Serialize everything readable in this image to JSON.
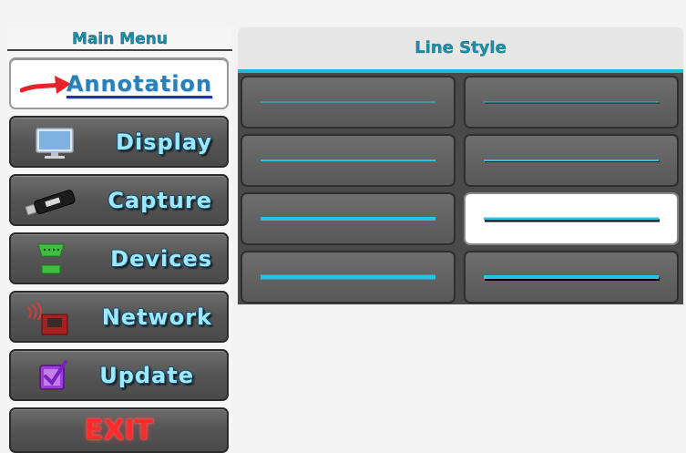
{
  "sidebar": {
    "title": "Main Menu",
    "items": [
      {
        "label": "Annotation",
        "icon": "red-arrow-icon",
        "active": true
      },
      {
        "label": "Display",
        "icon": "monitor-icon"
      },
      {
        "label": "Capture",
        "icon": "usb-stick-icon"
      },
      {
        "label": "Devices",
        "icon": "serial-port-icon"
      },
      {
        "label": "Network",
        "icon": "network-port-icon"
      },
      {
        "label": "Update",
        "icon": "checkbox-icon"
      },
      {
        "label": "EXIT",
        "icon": "exit-sign-icon"
      }
    ]
  },
  "panel": {
    "title": "Line Style",
    "accent_color": "#29c3e8",
    "line_options": [
      {
        "style": "thin-1",
        "shadow": false
      },
      {
        "style": "thin-1",
        "shadow": true
      },
      {
        "style": "thin-2",
        "shadow": false
      },
      {
        "style": "thin-2",
        "shadow": true
      },
      {
        "style": "medium",
        "shadow": false
      },
      {
        "style": "medium",
        "shadow": true,
        "selected": true
      },
      {
        "style": "thick",
        "shadow": false
      },
      {
        "style": "thick",
        "shadow": true
      }
    ]
  }
}
